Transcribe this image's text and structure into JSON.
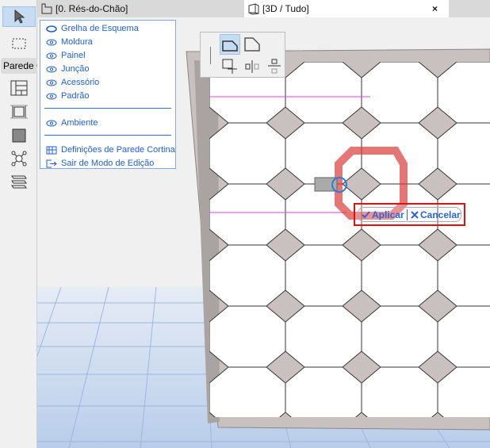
{
  "toolbox": {
    "section_label": "Parede C"
  },
  "tabs": [
    {
      "label": "[0. Rés-do-Chão]",
      "icon": "floor-plan-icon"
    },
    {
      "label": "[3D / Tudo]",
      "icon": "3d-box-icon",
      "close": "×"
    }
  ],
  "menu": {
    "items": [
      {
        "label": "Grelha de Esquema",
        "icon": "eye-closed-icon"
      },
      {
        "label": "Moldura",
        "icon": "eye-icon"
      },
      {
        "label": "Painel",
        "icon": "eye-icon"
      },
      {
        "label": "Junção",
        "icon": "eye-icon"
      },
      {
        "label": "Acessório",
        "icon": "eye-icon"
      },
      {
        "label": "Padrão",
        "icon": "eye-icon"
      }
    ],
    "ambient": "Ambiente",
    "settings": "Definições de Parede Cortina",
    "exit": "Sair de Modo de Edição"
  },
  "confirm": {
    "apply": "Aplicar",
    "cancel": "Cancelar",
    "accent": "#2a64e0",
    "highlight": "#e01010"
  }
}
